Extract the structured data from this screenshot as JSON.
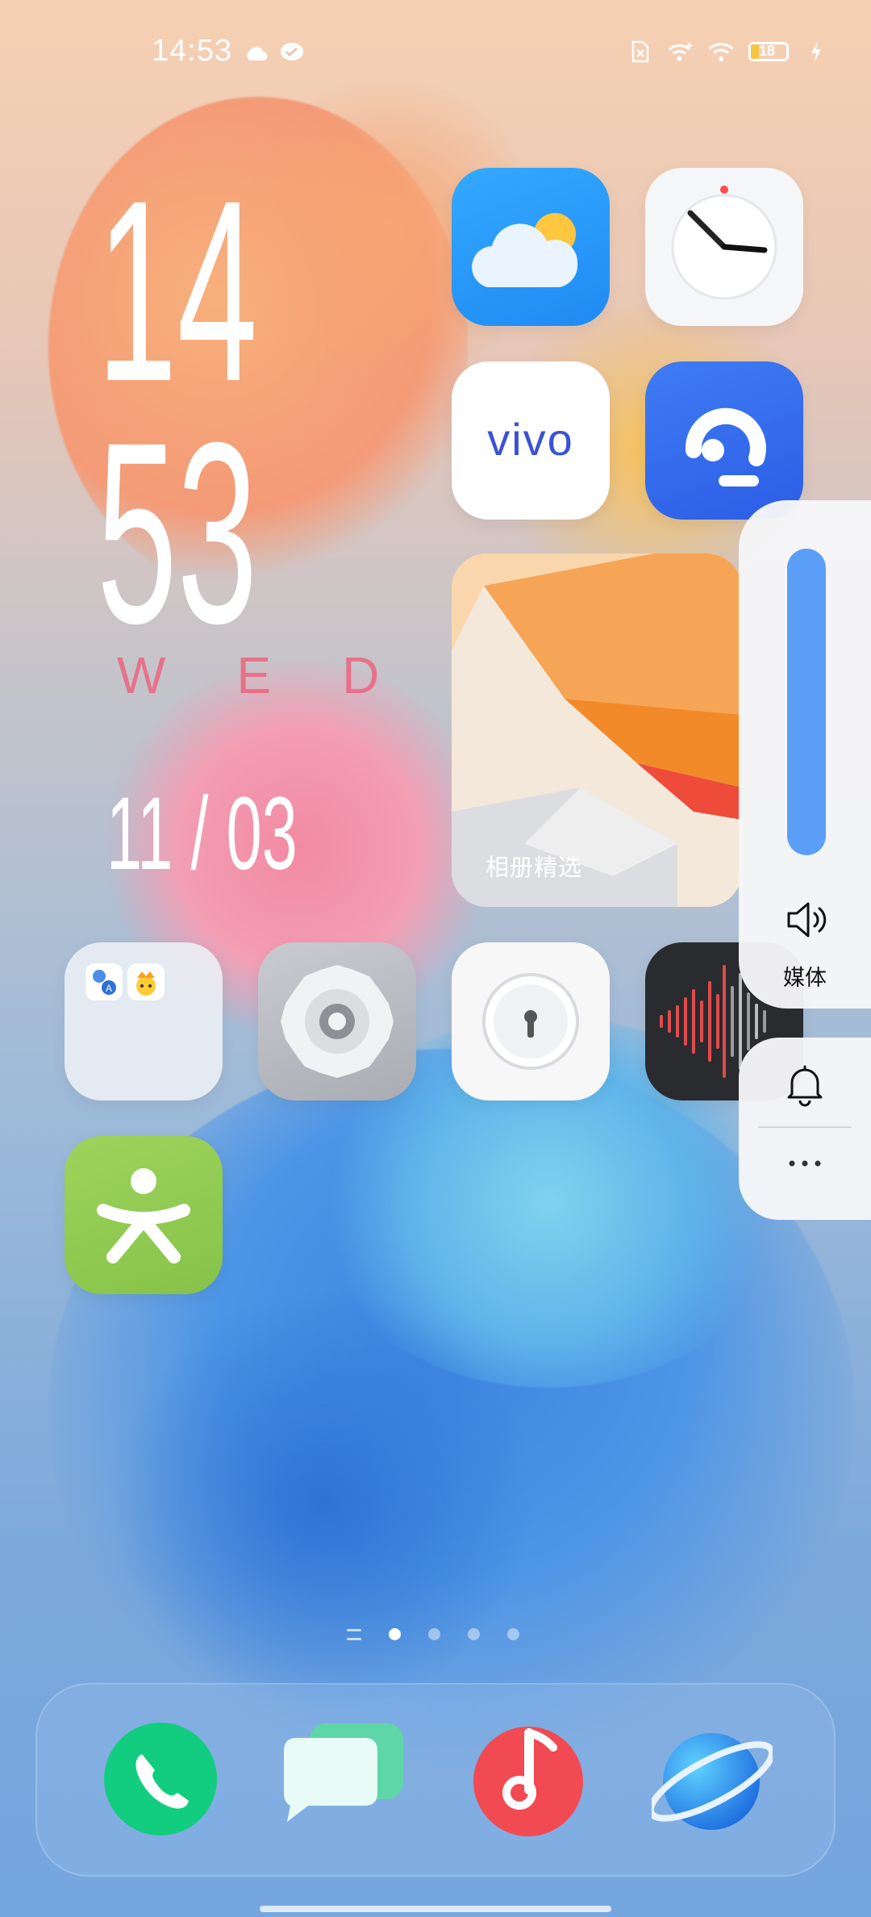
{
  "status_bar": {
    "time": "14:53",
    "battery_level": "18",
    "icons_left": [
      "cloud-icon",
      "message-bubble-icon"
    ],
    "icons_right": [
      "sim-card-icon",
      "mobile-signal-icon",
      "wifi-icon",
      "battery-icon",
      "charging-icon"
    ]
  },
  "clock_widget": {
    "hour": "14",
    "minute": "53",
    "day": "WED",
    "date": "11 / 03"
  },
  "apps": [
    {
      "name": "weather-app",
      "icon": "weather-cloud-sun-icon"
    },
    {
      "name": "clock-app",
      "icon": "clock-face-icon"
    },
    {
      "name": "vivo-app",
      "icon": "vivo-logo-icon",
      "logo_text": "vivo"
    },
    {
      "name": "customer-service-app",
      "icon": "headset-icon"
    },
    {
      "name": "app-folder",
      "icon": "folder-icon"
    },
    {
      "name": "settings-app",
      "icon": "gear-icon"
    },
    {
      "name": "password-manager-app",
      "icon": "lock-icon"
    },
    {
      "name": "voice-recorder-app",
      "icon": "waveform-icon"
    },
    {
      "name": "fitness-app",
      "icon": "person-stretch-icon"
    }
  ],
  "photo_widget": {
    "label": "相册精选"
  },
  "volume_panel": {
    "level": 1.0,
    "label": "媒体",
    "accent": "#5b9ef7"
  },
  "page_indicator": {
    "pages": 4,
    "active": 0
  },
  "dock": [
    {
      "name": "phone-app",
      "icon": "phone-icon"
    },
    {
      "name": "messages-app",
      "icon": "chat-bubbles-icon"
    },
    {
      "name": "music-app",
      "icon": "music-note-icon"
    },
    {
      "name": "browser-app",
      "icon": "planet-icon"
    }
  ]
}
